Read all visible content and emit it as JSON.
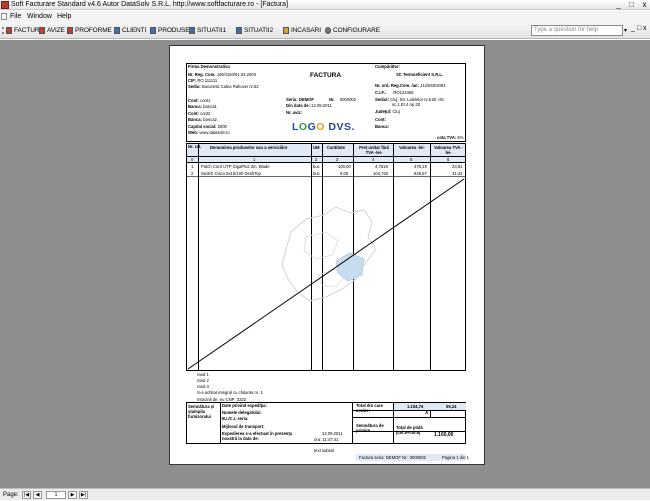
{
  "window": {
    "title": "Soft Facturare Standard v4.6 Autor DataSolv S.R.L. http://www.softfacturare.ro - [Factura]",
    "minimize": "_",
    "restore": "□",
    "close": "x"
  },
  "menu": [
    "File",
    "Window",
    "Help"
  ],
  "toolbar": [
    "FACTURI",
    "AVIZE",
    "PROFORME",
    "CLIENTI",
    "PRODUSE",
    "SITUATII1",
    "SITUATII2",
    "INCASARI",
    "CONFIGURARE"
  ],
  "help_box": {
    "placeholder": "Type a question for help"
  },
  "child_controls": {
    "min": "_",
    "restore": "□",
    "close": "x"
  },
  "invoice": {
    "supplier": {
      "name": "Firma Demonstrativa",
      "reg_label": "Nr. Reg. Com.",
      "reg_value": "J40/4184/01.03.2003",
      "cif_label": "CIF:",
      "cif_value": "RO 111111",
      "sediu_label": "Sediu:",
      "sediu_value": "Bucuresti Calea Rahovei nr.52",
      "cont1_label": "Cont:",
      "cont1_value": "cont1",
      "banca1_label": "Banca:",
      "banca1_value": "banca1",
      "cont2_label": "Cont:",
      "cont2_value": "cont2",
      "banca2_label": "Banca:",
      "banca2_value": "banca2",
      "capital_label": "Capital social:",
      "capital_value": "2000",
      "web_label": "Web:",
      "web_value": "www.datasolv.ro"
    },
    "title": "FACTURA",
    "serie_label": "Seria:",
    "serie_value": "DEMOF",
    "nr_label": "Nr.",
    "nr_value": "0000002",
    "date_label": "Din data de:",
    "date_value": "12.09.2011",
    "aviz_label": "Nr. aviz:",
    "aviz_value": "",
    "logo": {
      "text": "LOGO DVS."
    },
    "buyer": {
      "heading": "Cumpărător:",
      "name": "SC Termoeficient S.R.L.",
      "reg_label": "Nr. ord. Reg.Com. /an:",
      "reg_value": "J12/845/2004",
      "cif_label": "C.I.F.:",
      "cif_value": "RO123456",
      "sediu_label": "Sediul:",
      "sediu_line1": "Cluj, Str. Lalelelor nr.6 Bl. H5",
      "sediu_line2": "sc.1 Et.4 Ap.20",
      "judet_label": "Judeţul:",
      "judet_value": "Cluj",
      "cont_label": "Cont:",
      "cont_value": "",
      "banca_label": "Banca:",
      "banca_value": ""
    },
    "vat_rate_label": "cota TVA:",
    "vat_rate_value": "5%",
    "columns": [
      "Nr. crt.",
      "Denumirea produselor sau a serviciilor",
      "UM",
      "Cantitate",
      "Preţ unitar fără TVA -lei-",
      "Valoarea -lei-",
      "Valoarea TVA -lei-"
    ],
    "column_index": [
      "0",
      "1",
      "2",
      "3",
      "4",
      "5",
      "6"
    ],
    "rows": [
      {
        "nr": "1",
        "name": "Patch Cord UTP GigaPlus 2m, Blade",
        "um": "buc",
        "qty": "100,00",
        "price": "4,7619",
        "value": "476,19",
        "vat": "23,81"
      },
      {
        "nr": "2",
        "name": "Switch Cisco 8x10/100 DeskTop",
        "um": "buc",
        "qty": "6,00",
        "price": "104,762",
        "value": "628,57",
        "vat": "31,43"
      }
    ],
    "notes": [
      "rand 1",
      "rand 2",
      "rand 3",
      "S-a achitat integral cu chitanta nr. 1",
      "Intocmit de: eu CNP: 3322"
    ],
    "footer": {
      "signature_label": "Semnătura şi ştampila furnizorului",
      "expedition_label": "Date privind expediţia:",
      "delegate_label": "Numele delegatului:",
      "id_label": "B.I./C.I. seria:",
      "transport_label": "Mijlocul de transport:",
      "shipping_label": "Expedierea s-a efectuat în prezenţa noastră la data de:",
      "shipping_date": "12.09.2011",
      "time_label": "ora:",
      "time_value": "11:47:41",
      "total_label": "Total din care accize:",
      "total_value": "1.104,76",
      "total_vat": "55,24",
      "excise_value": "X",
      "receiver_label": "Semnătura de primire",
      "payment_label": "Total de plată (col.5+col.6)",
      "payment_value": "1.160,00"
    },
    "subtext": "text subsol",
    "bottom_series_label": "Factura seria:",
    "bottom_series": "DEMOF",
    "bottom_nr_label": "Nr.:",
    "bottom_nr": "0000002",
    "page_label": "Pagina 1 din 1"
  },
  "statusbar": {
    "page_label": "Page:",
    "page_value": "1",
    "first": "|◀",
    "prev": "◀",
    "next": "▶",
    "last": "▶|"
  },
  "colors": {
    "workspace": "#8e8e8e",
    "header_fill": "#dfeaf6",
    "map_fill": "#c8dcef",
    "logo_blue": "#1f4aa0"
  }
}
